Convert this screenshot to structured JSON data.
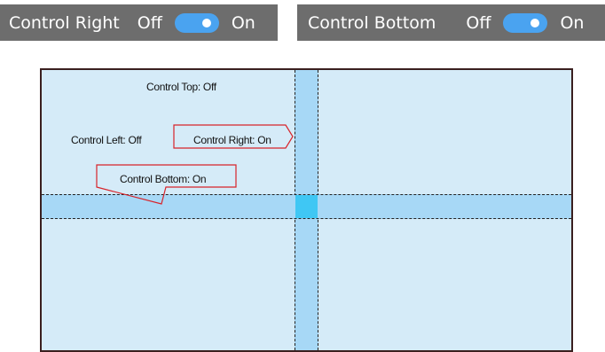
{
  "toolbars": [
    {
      "label": "Control Right",
      "off_label": "Off",
      "on_label": "On",
      "toggle_state": "on"
    },
    {
      "label": "Control Bottom",
      "off_label": "Off",
      "on_label": "On",
      "toggle_state": "on"
    }
  ],
  "canvas": {
    "labels": {
      "top": "Control Top: Off",
      "left": "Control Left: Off",
      "right": "Control Right: On",
      "bottom": "Control Bottom: On"
    }
  },
  "colors": {
    "toolbar_bg": "#6d6d6d",
    "toggle_accent": "#4aa3f0",
    "canvas_bg": "#d5ebf8",
    "band": "#a7d8f6",
    "intersection": "#3fc7f4",
    "callout_stroke": "#d8232a",
    "canvas_border": "#3a1f1f"
  }
}
